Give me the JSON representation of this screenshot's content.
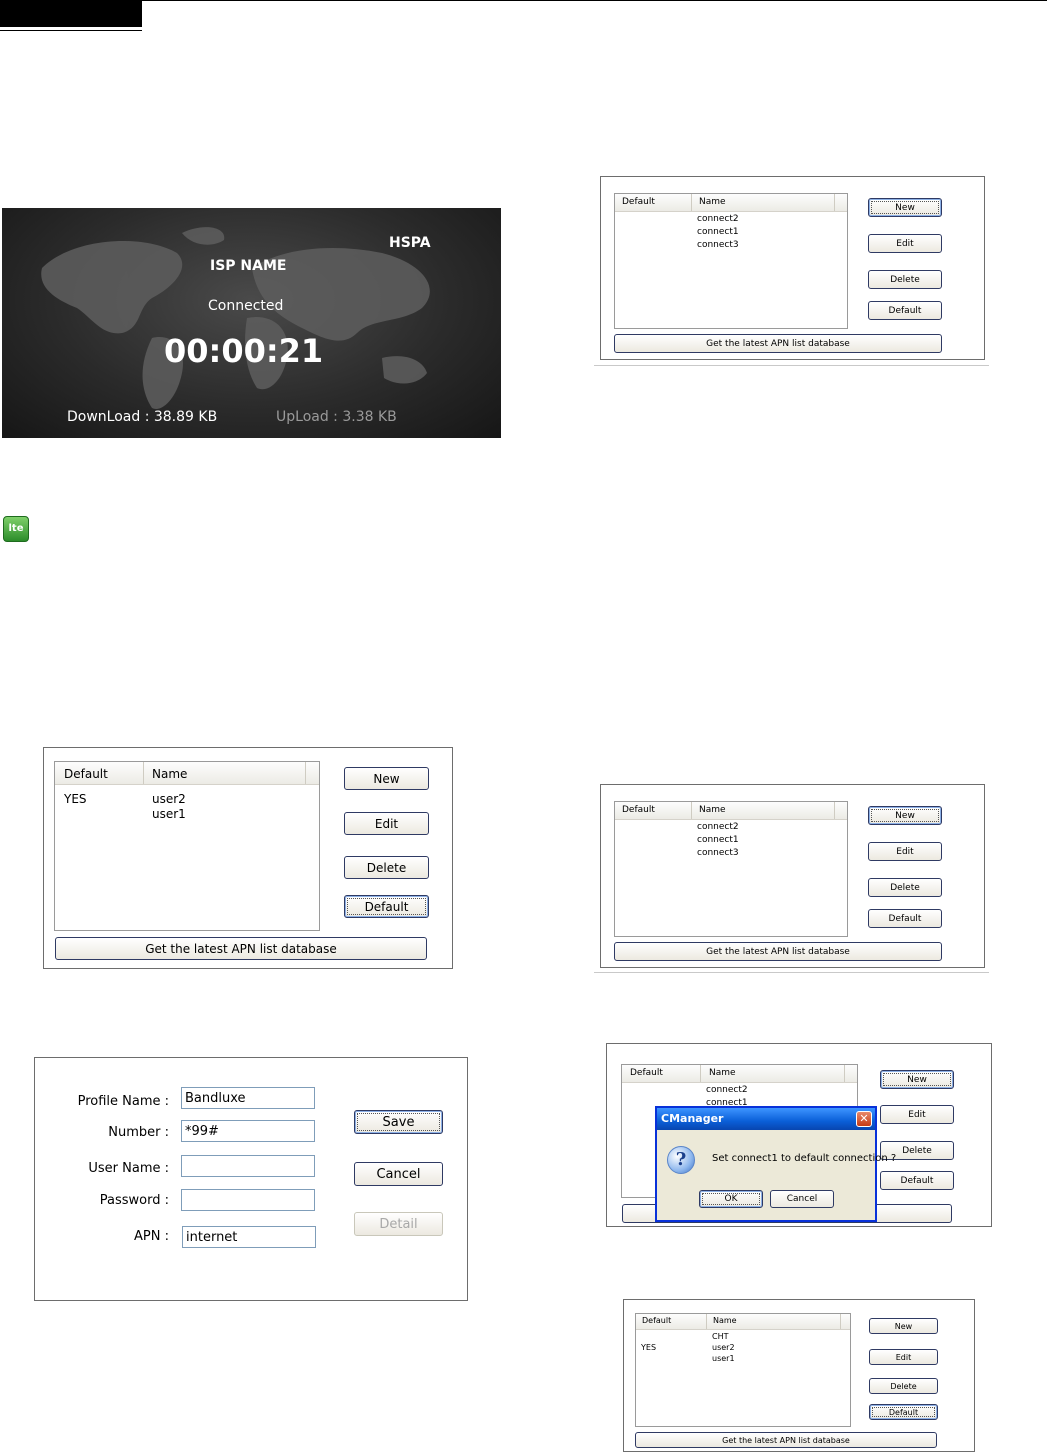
{
  "status_panel": {
    "network_type": "HSPA",
    "isp_name": "ISP NAME",
    "connection_state": "Connected",
    "elapsed_time": "00:00:21",
    "download": "DownLoad : 38.89 KB",
    "upload": "UpLoad : 3.38 KB"
  },
  "lte_icon": {
    "label": "lte",
    "color": "#3a9a2f"
  },
  "profile_list_main": {
    "columns": [
      "Default",
      "Name"
    ],
    "rows": [
      {
        "default": "YES",
        "name": "user2"
      },
      {
        "default": "",
        "name": "user1"
      }
    ],
    "buttons": {
      "new": "New",
      "edit": "Edit",
      "delete": "Delete",
      "default": "Default"
    },
    "apn_button": "Get the latest APN list database"
  },
  "profile_form": {
    "labels": {
      "profile_name": "Profile Name :",
      "number": "Number :",
      "user_name": "User Name :",
      "password": "Password :",
      "apn": "APN :"
    },
    "values": {
      "profile_name": "Bandluxe",
      "number": "*99#",
      "user_name": "",
      "password": "",
      "apn": "internet"
    },
    "buttons": {
      "save": "Save",
      "cancel": "Cancel",
      "detail": "Detail"
    }
  },
  "profile_list_top": {
    "columns": [
      "Default",
      "Name"
    ],
    "rows": [
      {
        "default": "",
        "name": "connect2"
      },
      {
        "default": "",
        "name": "connect1"
      },
      {
        "default": "",
        "name": "connect3"
      }
    ],
    "buttons": {
      "new": "New",
      "edit": "Edit",
      "delete": "Delete",
      "default": "Default"
    },
    "apn_button": "Get the latest APN list database"
  },
  "profile_list_mid": {
    "columns": [
      "Default",
      "Name"
    ],
    "rows": [
      {
        "default": "",
        "name": "connect2"
      },
      {
        "default": "",
        "name": "connect1"
      },
      {
        "default": "",
        "name": "connect3"
      }
    ],
    "buttons": {
      "new": "New",
      "edit": "Edit",
      "delete": "Delete",
      "default": "Default"
    },
    "apn_button": "Get the latest APN list database"
  },
  "profile_list_dialog": {
    "columns": [
      "Default",
      "Name"
    ],
    "rows": [
      {
        "default": "",
        "name": "connect2"
      },
      {
        "default": "",
        "name": "connect1"
      }
    ],
    "buttons": {
      "new": "New",
      "edit": "Edit",
      "delete": "Delete",
      "default": "Default"
    }
  },
  "confirm_dialog": {
    "title": "CManager",
    "message": "Set connect1 to default connection ?",
    "ok": "OK",
    "cancel": "Cancel"
  },
  "profile_list_bottom": {
    "columns": [
      "Default",
      "Name"
    ],
    "rows": [
      {
        "default": "",
        "name": "CHT"
      },
      {
        "default": "YES",
        "name": "user2"
      },
      {
        "default": "",
        "name": "user1"
      }
    ],
    "buttons": {
      "new": "New",
      "edit": "Edit",
      "delete": "Delete",
      "default": "Default"
    },
    "apn_button": "Get the latest APN list database"
  }
}
